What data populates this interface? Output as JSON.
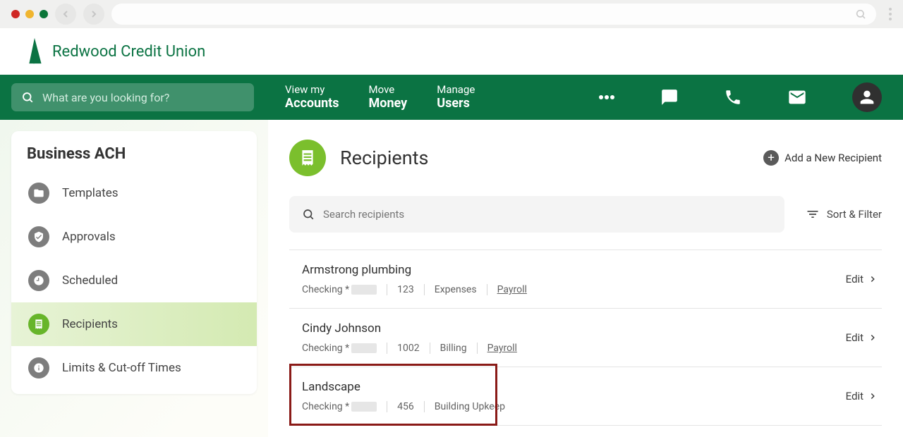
{
  "brand": "Redwood Credit Union",
  "nav": {
    "search_placeholder": "What are you looking for?",
    "links": [
      {
        "top": "View my",
        "bot": "Accounts"
      },
      {
        "top": "Move",
        "bot": "Money"
      },
      {
        "top": "Manage",
        "bot": "Users"
      }
    ]
  },
  "sidebar": {
    "title": "Business ACH",
    "items": [
      {
        "label": "Templates"
      },
      {
        "label": "Approvals"
      },
      {
        "label": "Scheduled"
      },
      {
        "label": "Recipients"
      },
      {
        "label": "Limits & Cut-off Times"
      }
    ]
  },
  "page": {
    "title": "Recipients",
    "add_label": "Add a New Recipient",
    "search_placeholder": "Search recipients",
    "sort_label": "Sort & Filter",
    "edit_label": "Edit"
  },
  "recipients": [
    {
      "name": "Armstrong plumbing",
      "account_type": "Checking *",
      "segments": [
        "123",
        "Expenses",
        "Payroll"
      ],
      "underline_last": true
    },
    {
      "name": "Cindy Johnson",
      "account_type": "Checking *",
      "segments": [
        "1002",
        "Billing",
        "Payroll"
      ],
      "underline_last": true
    },
    {
      "name": "Landscape",
      "account_type": "Checking *",
      "segments": [
        "456",
        "Building Upkeep"
      ],
      "underline_last": false
    }
  ],
  "highlight_index": 2
}
